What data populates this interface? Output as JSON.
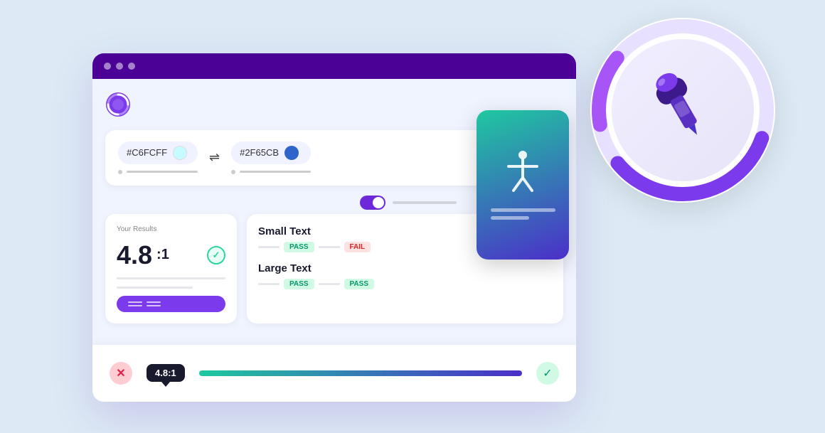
{
  "browser": {
    "titlebar_dots": [
      "dot1",
      "dot2",
      "dot3"
    ]
  },
  "color_picker": {
    "color1_value": "#C6FCFF",
    "color1_swatch": "#C6FCFF",
    "color2_value": "#2F65CB",
    "color2_swatch": "#2F65CB"
  },
  "results": {
    "label": "Your Results",
    "ratio": "4.8",
    "ratio_suffix": ":1",
    "button_label": "——  ————"
  },
  "text_section": {
    "small_text_label": "Small Text",
    "large_text_label": "Large Text",
    "small_badge1": "PASS",
    "small_badge2": "FAIL",
    "large_badge1": "PASS",
    "large_badge2": "PASS"
  },
  "bottom_bar": {
    "ratio_label": "4.8:1"
  }
}
